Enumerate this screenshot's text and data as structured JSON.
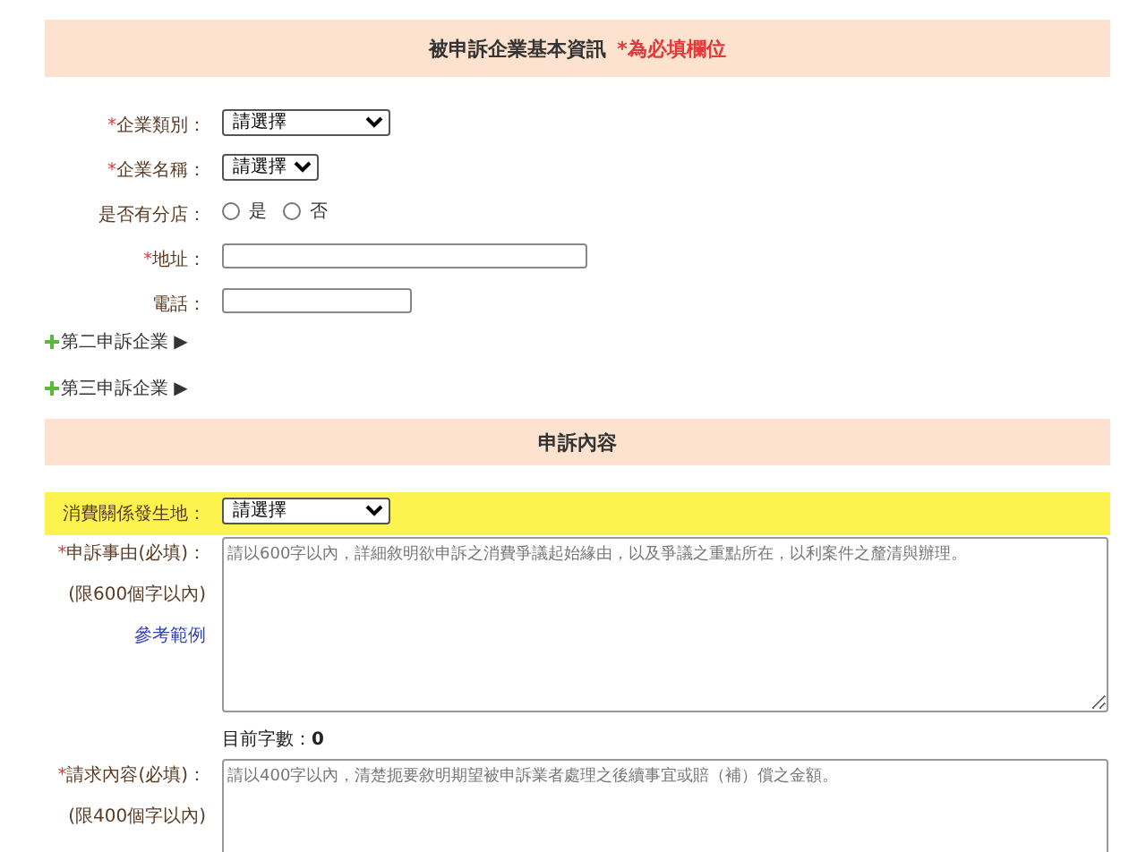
{
  "sections": [
    {
      "title": "被申訴企業基本資訊",
      "note": "*為必填欄位",
      "rows": [
        {
          "kind": "select",
          "required_mark": "*",
          "label": "企業類別：",
          "value": "請選擇"
        },
        {
          "kind": "select",
          "required_mark": "*",
          "label": "企業名稱：",
          "value": "請選擇"
        },
        {
          "kind": "radio",
          "label": "是否有分店：",
          "options": [
            {
              "label": "是",
              "selected": false
            },
            {
              "label": "否",
              "selected": false
            }
          ]
        },
        {
          "kind": "text",
          "required_mark": "*",
          "label": "地址："
        },
        {
          "kind": "text",
          "label": "電話："
        }
      ],
      "expanders": [
        {
          "label": "第二申訴企業",
          "arrow": "▶"
        },
        {
          "label": "第三申訴企業",
          "arrow": "▶"
        }
      ]
    },
    {
      "title": "申訴內容",
      "rows": [
        {
          "kind": "select",
          "label": "消費關係發生地：",
          "value": "請選擇",
          "highlighted": true
        },
        {
          "kind": "textarea",
          "required_mark": "*",
          "label": "申訴事由(必填)：",
          "limit": "(限600個字以內)",
          "link": "參考範例",
          "placeholder": "請以600字以內，詳細敘明欲申訴之消費爭議起始緣由，以及爭議之重點所在，以利案件之釐清與辦理。",
          "counter": "目前字數：**0**"
        },
        {
          "kind": "textarea",
          "required_mark": "*",
          "label": "請求內容(必填)：",
          "limit": "(限400個字以內)",
          "placeholder": "請以400字以內，清楚扼要敘明期望被申訴業者處理之後續事宜或賠（補）償之金額。"
        }
      ]
    }
  ]
}
